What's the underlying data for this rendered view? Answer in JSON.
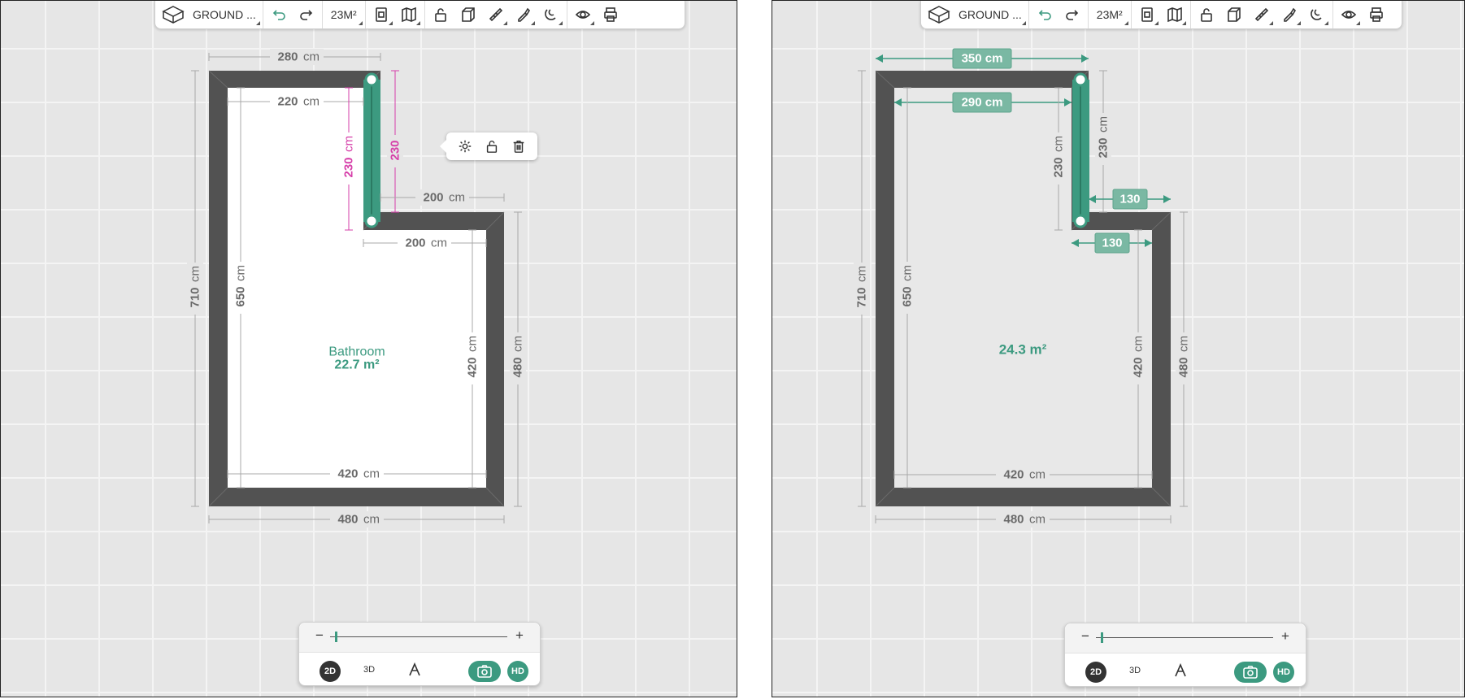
{
  "left": {
    "toolbar": {
      "floor_label": "GROUND ...",
      "area_label": "23M²"
    },
    "dims": {
      "top_outer": "280",
      "top_inner": "220",
      "wall_inner_len": "230",
      "wall_outer_len": "230",
      "step_outer": "200",
      "step_inner": "200",
      "left_outer": "710",
      "left_inner": "650",
      "right_inner": "420",
      "right_outer": "480",
      "bottom_inner": "420",
      "bottom_outer": "480",
      "unit": "cm"
    },
    "room": {
      "name": "Bathroom",
      "area": "22.7 m²"
    },
    "context_menu": [
      "settings-icon",
      "unlock-icon",
      "trash-icon"
    ],
    "bottombar": {
      "zoom_level": 0.03,
      "view_2d": "2D",
      "view_3d": "3D",
      "hd": "HD"
    }
  },
  "right": {
    "toolbar": {
      "floor_label": "GROUND ...",
      "area_label": "23M²"
    },
    "dims": {
      "top_outer": "350",
      "top_inner": "290",
      "wall_inner_len": "230",
      "wall_outer_len": "230",
      "step_outer": "130",
      "step_inner": "130",
      "left_outer": "710",
      "left_inner": "650",
      "right_inner": "420",
      "right_outer": "480",
      "bottom_inner": "420",
      "bottom_outer": "480",
      "unit": "cm"
    },
    "room": {
      "area": "24.3 m²"
    },
    "bottombar": {
      "zoom_level": 0.03,
      "view_2d": "2D",
      "view_3d": "3D",
      "hd": "HD"
    }
  },
  "colors": {
    "accent": "#3c9a80",
    "wall": "#525252",
    "dimension_highlight": "#d63fa9"
  }
}
